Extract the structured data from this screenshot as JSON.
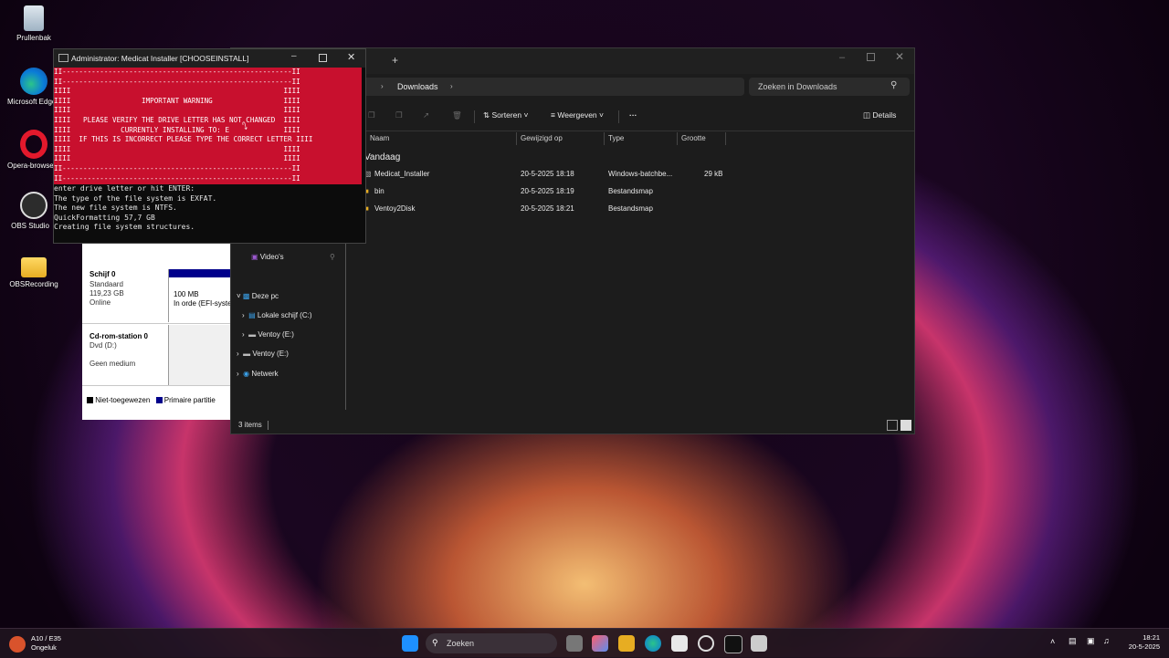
{
  "desktop": {
    "icons": [
      {
        "label": "Prullenbak"
      },
      {
        "label": "Microsoft Edge"
      },
      {
        "label": "Opera-browser"
      },
      {
        "label": "OBS Studio"
      },
      {
        "label": "OBSRecording"
      }
    ]
  },
  "cmd": {
    "title": "Administrator: Medicat Installer [CHOOSEINSTALL]",
    "warning_lines": [
      "II-------------------------------------------------------II",
      "II-------------------------------------------------------II",
      "IIII                                                   IIII",
      "IIII                 IMPORTANT WARNING                 IIII",
      "IIII                                                   IIII",
      "IIII   PLEASE VERIFY THE DRIVE LETTER HAS NOT CHANGED  IIII",
      "IIII            CURRENTLY INSTALLING TO: E             IIII",
      "IIII  IF THIS IS INCORRECT PLEASE TYPE THE CORRECT LETTER IIII",
      "IIII                                                   IIII",
      "IIII                                                   IIII",
      "II-------------------------------------------------------II",
      "II-------------------------------------------------------II"
    ],
    "output_lines": [
      "enter drive letter or hit ENTER:",
      "The type of the file system is EXFAT.",
      "The new file system is NTFS.",
      "QuickFormatting 57,7 GB",
      "Creating file system structures."
    ]
  },
  "diskmgmt": {
    "disk0_name": "Schijf 0",
    "disk0_type": "Standaard",
    "disk0_size": "119,23 GB",
    "disk0_status": "Online",
    "partition_size": "100 MB",
    "partition_status": "In orde (EFI-systeem",
    "cdrom_name": "Cd-rom-station 0",
    "cdrom_drive": "Dvd (D:)",
    "cdrom_status": "Geen medium",
    "legend_unallocated": "Niet-toegewezen",
    "legend_primary": "Primaire partitie"
  },
  "explorer": {
    "new_tab": "+",
    "breadcrumb": "Downloads",
    "search_placeholder": "Zoeken in Downloads",
    "toolbar": {
      "sort": "Sorteren",
      "view": "Weergeven",
      "more": "···",
      "details": "Details"
    },
    "columns": {
      "name": "Naam",
      "modified": "Gewijzigd op",
      "type": "Type",
      "size": "Grootte"
    },
    "group": "Vandaag",
    "files": [
      {
        "name": "Medicat_Installer",
        "modified": "20-5-2025 18:18",
        "type": "Windows-batchbe...",
        "size": "29 kB"
      },
      {
        "name": "bin",
        "modified": "20-5-2025 18:19",
        "type": "Bestandsmap",
        "size": ""
      },
      {
        "name": "Ventoy2Disk",
        "modified": "20-5-2025 18:21",
        "type": "Bestandsmap",
        "size": ""
      }
    ],
    "nav": {
      "videos": "Video's",
      "this_pc": "Deze pc",
      "local_disk": "Lokale schijf (C:)",
      "ventoy_e1": "Ventoy (E:)",
      "ventoy_e2": "Ventoy (E:)",
      "network": "Netwerk"
    },
    "status": "3 items"
  },
  "taskbar": {
    "weather_title": "A10 / E35",
    "weather_sub": "Ongeluk",
    "search": "Zoeken",
    "time": "18:21",
    "date": "20-5-2025"
  },
  "colors": {
    "warning_red": "#c8102e",
    "accent_blue": "#0078d4"
  }
}
